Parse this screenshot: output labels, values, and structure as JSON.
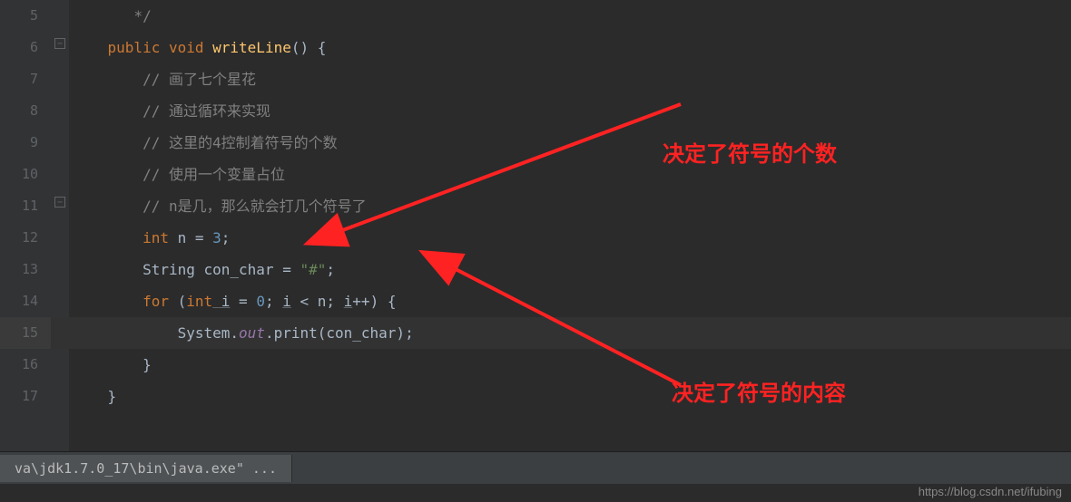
{
  "lines": {
    "start": 5,
    "numbers": [
      "5",
      "6",
      "7",
      "8",
      "9",
      "10",
      "11",
      "12",
      "13",
      "14",
      "15",
      "16",
      "17"
    ]
  },
  "code": {
    "l5": "*/",
    "l6_public": "public",
    "l6_void": "void",
    "l6_method": "writeLine",
    "l6_rest": "() {",
    "l7": "// 画了七个星花",
    "l8": "// 通过循环来实现",
    "l9": "// 这里的4控制着符号的个数",
    "l10": "// 使用一个变量占位",
    "l11": "// n是几，那么就会打几个符号了",
    "l12_int": "int",
    "l12_var": " n = ",
    "l12_num": "3",
    "l12_semi": ";",
    "l13_type": "String con_char = ",
    "l13_str": "\"#\"",
    "l13_semi": ";",
    "l14_for": "for",
    "l14_open": " (",
    "l14_int": "int",
    "l14_i": " i",
    "l14_eq": " = ",
    "l14_zero": "0",
    "l14_mid": "; ",
    "l14_i2": "i",
    "l14_lt": " < n; ",
    "l14_i3": "i",
    "l14_inc": "++) {",
    "l15_sys": "System.",
    "l15_out": "out",
    "l15_print": ".print(con_char);",
    "l16": "}",
    "l17": "}"
  },
  "annotations": {
    "a1": "决定了符号的个数",
    "a2": "决定了符号的内容"
  },
  "bottom": {
    "path": "va\\jdk1.7.0_17\\bin\\java.exe\" ..."
  },
  "watermark": "https://blog.csdn.net/ifubing"
}
